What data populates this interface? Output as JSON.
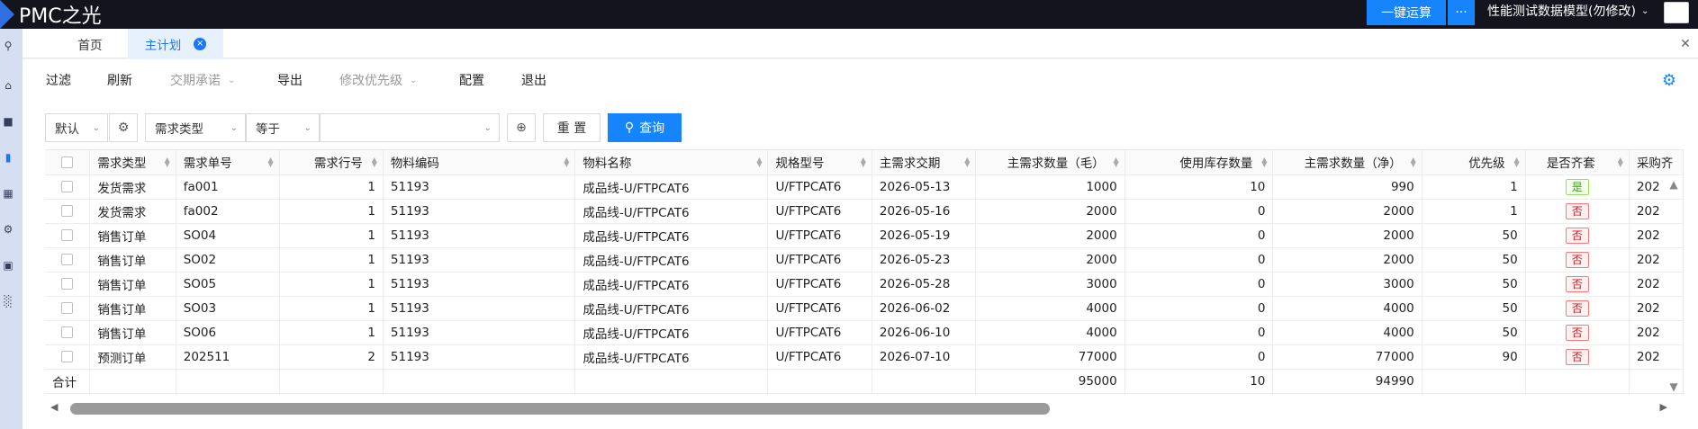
{
  "app": {
    "title": "PMC之光",
    "run_label": "一键运算",
    "more_label": "···",
    "model_label": "性能测试数据模型(勿修改)"
  },
  "tabs": [
    {
      "label": "首页"
    },
    {
      "label": "主计划",
      "close": "×"
    }
  ],
  "toolbar": {
    "filter": "过滤",
    "refresh": "刷新",
    "delivery": "交期承诺",
    "export": "导出",
    "priority": "修改优先级",
    "config": "配置",
    "exit": "退出"
  },
  "filterbar": {
    "scheme": "默认",
    "field": "需求类型",
    "operator": "等于",
    "value": "",
    "reset": "重 置",
    "query": "查询"
  },
  "columns": [
    "需求类型",
    "需求单号",
    "需求行号",
    "物料编码",
    "物料名称",
    "规格型号",
    "主需求交期",
    "主需求数量（毛）",
    "使用库存数量",
    "主需求数量（净）",
    "优先级",
    "是否齐套",
    "采购齐"
  ],
  "rows": [
    {
      "type": "发货需求",
      "no": "fa001",
      "line": "1",
      "code": "51193",
      "name": "成品线-U/FTPCAT6",
      "spec": "U/FTPCAT6",
      "date": "2026-05-13",
      "gross": "1000",
      "stock": "10",
      "net": "990",
      "priority": "1",
      "complete": "是",
      "purchase": "202"
    },
    {
      "type": "发货需求",
      "no": "fa002",
      "line": "1",
      "code": "51193",
      "name": "成品线-U/FTPCAT6",
      "spec": "U/FTPCAT6",
      "date": "2026-05-16",
      "gross": "2000",
      "stock": "0",
      "net": "2000",
      "priority": "1",
      "complete": "否",
      "purchase": "202"
    },
    {
      "type": "销售订单",
      "no": "SO04",
      "line": "1",
      "code": "51193",
      "name": "成品线-U/FTPCAT6",
      "spec": "U/FTPCAT6",
      "date": "2026-05-19",
      "gross": "2000",
      "stock": "0",
      "net": "2000",
      "priority": "50",
      "complete": "否",
      "purchase": "202"
    },
    {
      "type": "销售订单",
      "no": "SO02",
      "line": "1",
      "code": "51193",
      "name": "成品线-U/FTPCAT6",
      "spec": "U/FTPCAT6",
      "date": "2026-05-23",
      "gross": "2000",
      "stock": "0",
      "net": "2000",
      "priority": "50",
      "complete": "否",
      "purchase": "202"
    },
    {
      "type": "销售订单",
      "no": "SO05",
      "line": "1",
      "code": "51193",
      "name": "成品线-U/FTPCAT6",
      "spec": "U/FTPCAT6",
      "date": "2026-05-28",
      "gross": "3000",
      "stock": "0",
      "net": "3000",
      "priority": "50",
      "complete": "否",
      "purchase": "202"
    },
    {
      "type": "销售订单",
      "no": "SO03",
      "line": "1",
      "code": "51193",
      "name": "成品线-U/FTPCAT6",
      "spec": "U/FTPCAT6",
      "date": "2026-06-02",
      "gross": "4000",
      "stock": "0",
      "net": "4000",
      "priority": "50",
      "complete": "否",
      "purchase": "202"
    },
    {
      "type": "销售订单",
      "no": "SO06",
      "line": "1",
      "code": "51193",
      "name": "成品线-U/FTPCAT6",
      "spec": "U/FTPCAT6",
      "date": "2026-06-10",
      "gross": "4000",
      "stock": "0",
      "net": "4000",
      "priority": "50",
      "complete": "否",
      "purchase": "202"
    },
    {
      "type": "预测订单",
      "no": "202511",
      "line": "2",
      "code": "51193",
      "name": "成品线-U/FTPCAT6",
      "spec": "U/FTPCAT6",
      "date": "2026-07-10",
      "gross": "77000",
      "stock": "0",
      "net": "77000",
      "priority": "90",
      "complete": "否",
      "purchase": "202"
    }
  ],
  "summary": {
    "label": "合计",
    "gross": "95000",
    "stock": "10",
    "net": "94990"
  },
  "colors": {
    "accent": "#1684fc",
    "topbar": "#14141f",
    "sidebar": "#d6def2"
  }
}
